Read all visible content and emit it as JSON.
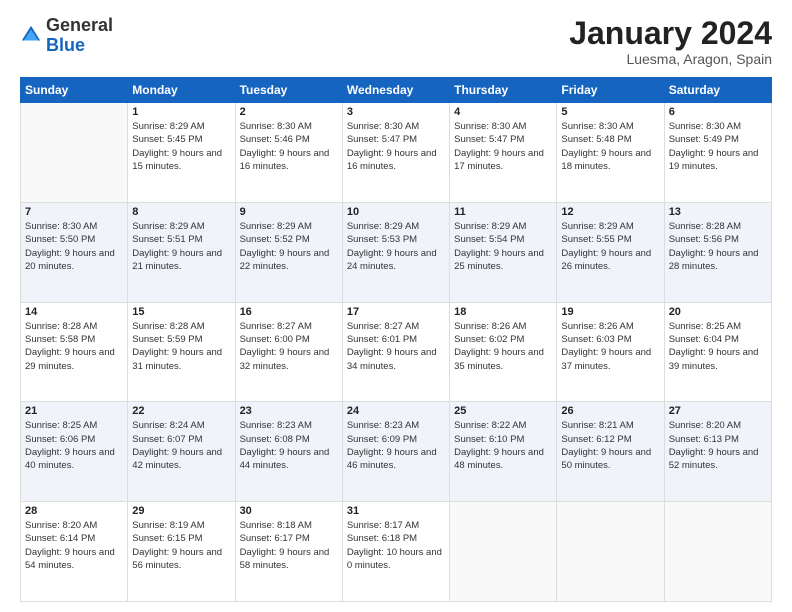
{
  "header": {
    "logo_general": "General",
    "logo_blue": "Blue",
    "title": "January 2024",
    "subtitle": "Luesma, Aragon, Spain"
  },
  "calendar": {
    "days_header": [
      "Sunday",
      "Monday",
      "Tuesday",
      "Wednesday",
      "Thursday",
      "Friday",
      "Saturday"
    ],
    "weeks": [
      [
        {
          "day": "",
          "empty": true
        },
        {
          "day": "1",
          "sunrise": "Sunrise: 8:29 AM",
          "sunset": "Sunset: 5:45 PM",
          "daylight": "Daylight: 9 hours and 15 minutes."
        },
        {
          "day": "2",
          "sunrise": "Sunrise: 8:30 AM",
          "sunset": "Sunset: 5:46 PM",
          "daylight": "Daylight: 9 hours and 16 minutes."
        },
        {
          "day": "3",
          "sunrise": "Sunrise: 8:30 AM",
          "sunset": "Sunset: 5:47 PM",
          "daylight": "Daylight: 9 hours and 16 minutes."
        },
        {
          "day": "4",
          "sunrise": "Sunrise: 8:30 AM",
          "sunset": "Sunset: 5:47 PM",
          "daylight": "Daylight: 9 hours and 17 minutes."
        },
        {
          "day": "5",
          "sunrise": "Sunrise: 8:30 AM",
          "sunset": "Sunset: 5:48 PM",
          "daylight": "Daylight: 9 hours and 18 minutes."
        },
        {
          "day": "6",
          "sunrise": "Sunrise: 8:30 AM",
          "sunset": "Sunset: 5:49 PM",
          "daylight": "Daylight: 9 hours and 19 minutes."
        }
      ],
      [
        {
          "day": "7",
          "sunrise": "Sunrise: 8:30 AM",
          "sunset": "Sunset: 5:50 PM",
          "daylight": "Daylight: 9 hours and 20 minutes."
        },
        {
          "day": "8",
          "sunrise": "Sunrise: 8:29 AM",
          "sunset": "Sunset: 5:51 PM",
          "daylight": "Daylight: 9 hours and 21 minutes."
        },
        {
          "day": "9",
          "sunrise": "Sunrise: 8:29 AM",
          "sunset": "Sunset: 5:52 PM",
          "daylight": "Daylight: 9 hours and 22 minutes."
        },
        {
          "day": "10",
          "sunrise": "Sunrise: 8:29 AM",
          "sunset": "Sunset: 5:53 PM",
          "daylight": "Daylight: 9 hours and 24 minutes."
        },
        {
          "day": "11",
          "sunrise": "Sunrise: 8:29 AM",
          "sunset": "Sunset: 5:54 PM",
          "daylight": "Daylight: 9 hours and 25 minutes."
        },
        {
          "day": "12",
          "sunrise": "Sunrise: 8:29 AM",
          "sunset": "Sunset: 5:55 PM",
          "daylight": "Daylight: 9 hours and 26 minutes."
        },
        {
          "day": "13",
          "sunrise": "Sunrise: 8:28 AM",
          "sunset": "Sunset: 5:56 PM",
          "daylight": "Daylight: 9 hours and 28 minutes."
        }
      ],
      [
        {
          "day": "14",
          "sunrise": "Sunrise: 8:28 AM",
          "sunset": "Sunset: 5:58 PM",
          "daylight": "Daylight: 9 hours and 29 minutes."
        },
        {
          "day": "15",
          "sunrise": "Sunrise: 8:28 AM",
          "sunset": "Sunset: 5:59 PM",
          "daylight": "Daylight: 9 hours and 31 minutes."
        },
        {
          "day": "16",
          "sunrise": "Sunrise: 8:27 AM",
          "sunset": "Sunset: 6:00 PM",
          "daylight": "Daylight: 9 hours and 32 minutes."
        },
        {
          "day": "17",
          "sunrise": "Sunrise: 8:27 AM",
          "sunset": "Sunset: 6:01 PM",
          "daylight": "Daylight: 9 hours and 34 minutes."
        },
        {
          "day": "18",
          "sunrise": "Sunrise: 8:26 AM",
          "sunset": "Sunset: 6:02 PM",
          "daylight": "Daylight: 9 hours and 35 minutes."
        },
        {
          "day": "19",
          "sunrise": "Sunrise: 8:26 AM",
          "sunset": "Sunset: 6:03 PM",
          "daylight": "Daylight: 9 hours and 37 minutes."
        },
        {
          "day": "20",
          "sunrise": "Sunrise: 8:25 AM",
          "sunset": "Sunset: 6:04 PM",
          "daylight": "Daylight: 9 hours and 39 minutes."
        }
      ],
      [
        {
          "day": "21",
          "sunrise": "Sunrise: 8:25 AM",
          "sunset": "Sunset: 6:06 PM",
          "daylight": "Daylight: 9 hours and 40 minutes."
        },
        {
          "day": "22",
          "sunrise": "Sunrise: 8:24 AM",
          "sunset": "Sunset: 6:07 PM",
          "daylight": "Daylight: 9 hours and 42 minutes."
        },
        {
          "day": "23",
          "sunrise": "Sunrise: 8:23 AM",
          "sunset": "Sunset: 6:08 PM",
          "daylight": "Daylight: 9 hours and 44 minutes."
        },
        {
          "day": "24",
          "sunrise": "Sunrise: 8:23 AM",
          "sunset": "Sunset: 6:09 PM",
          "daylight": "Daylight: 9 hours and 46 minutes."
        },
        {
          "day": "25",
          "sunrise": "Sunrise: 8:22 AM",
          "sunset": "Sunset: 6:10 PM",
          "daylight": "Daylight: 9 hours and 48 minutes."
        },
        {
          "day": "26",
          "sunrise": "Sunrise: 8:21 AM",
          "sunset": "Sunset: 6:12 PM",
          "daylight": "Daylight: 9 hours and 50 minutes."
        },
        {
          "day": "27",
          "sunrise": "Sunrise: 8:20 AM",
          "sunset": "Sunset: 6:13 PM",
          "daylight": "Daylight: 9 hours and 52 minutes."
        }
      ],
      [
        {
          "day": "28",
          "sunrise": "Sunrise: 8:20 AM",
          "sunset": "Sunset: 6:14 PM",
          "daylight": "Daylight: 9 hours and 54 minutes."
        },
        {
          "day": "29",
          "sunrise": "Sunrise: 8:19 AM",
          "sunset": "Sunset: 6:15 PM",
          "daylight": "Daylight: 9 hours and 56 minutes."
        },
        {
          "day": "30",
          "sunrise": "Sunrise: 8:18 AM",
          "sunset": "Sunset: 6:17 PM",
          "daylight": "Daylight: 9 hours and 58 minutes."
        },
        {
          "day": "31",
          "sunrise": "Sunrise: 8:17 AM",
          "sunset": "Sunset: 6:18 PM",
          "daylight": "Daylight: 10 hours and 0 minutes."
        },
        {
          "day": "",
          "empty": true
        },
        {
          "day": "",
          "empty": true
        },
        {
          "day": "",
          "empty": true
        }
      ]
    ]
  }
}
